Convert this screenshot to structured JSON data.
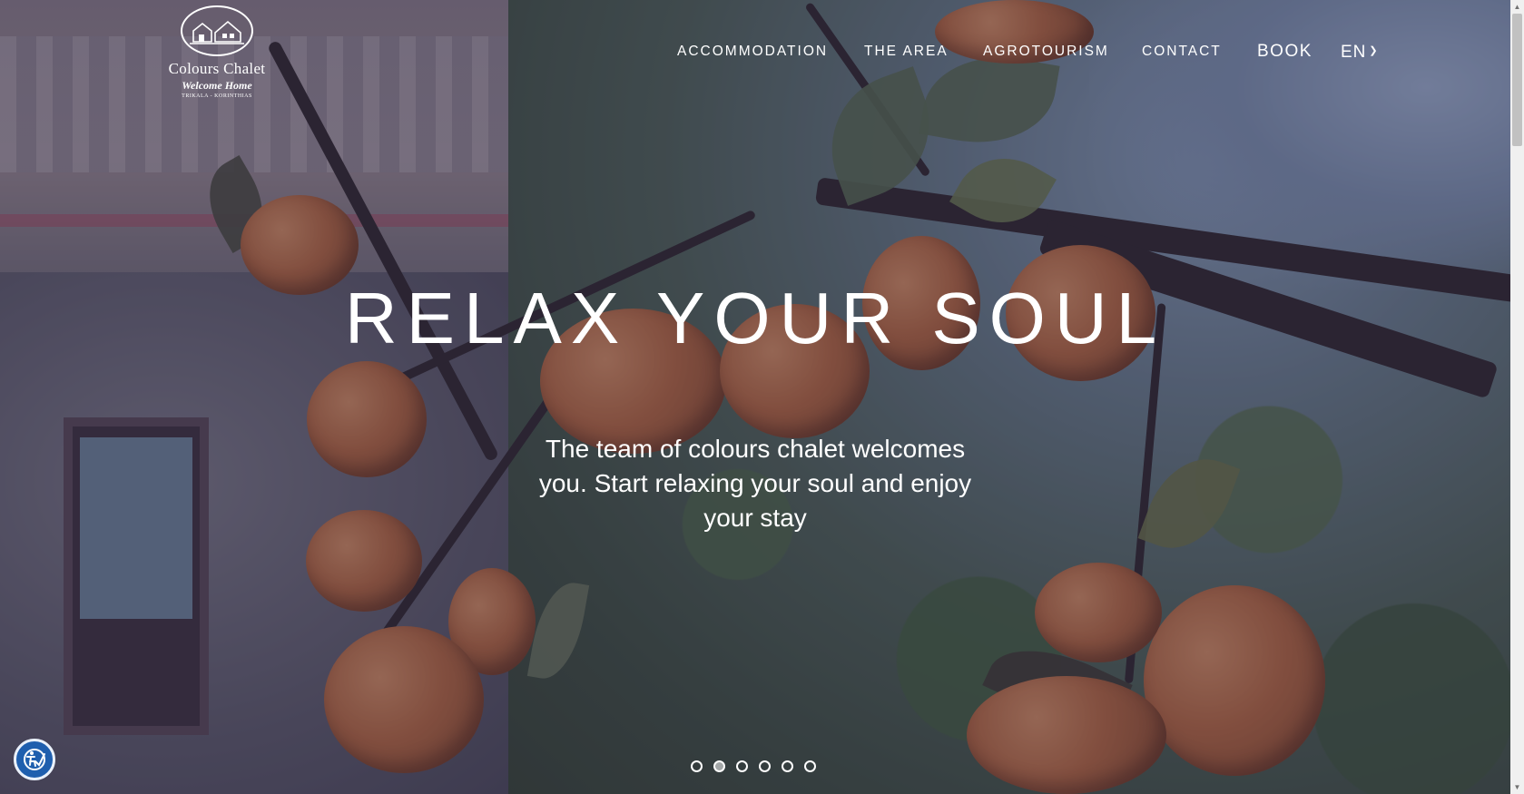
{
  "brand": {
    "name": "Colours Chalet",
    "tagline": "Welcome Home",
    "place": "TRIKALA - KORINTHIAS"
  },
  "nav": {
    "items": [
      {
        "label": "ACCOMMODATION"
      },
      {
        "label": "THE AREA"
      },
      {
        "label": "AGROTOURISM"
      },
      {
        "label": "CONTACT"
      },
      {
        "label": "BOOK"
      }
    ],
    "language": "EN"
  },
  "hero": {
    "title": "RELAX YOUR SOUL",
    "subtitle": "The team of colours chalet welcomes you. Start relaxing your soul and enjoy your stay"
  },
  "slider": {
    "total_slides": 6,
    "active_slide": 2
  },
  "accessibility": {
    "icon": "accessibility-icon",
    "color": "#1f5fae"
  },
  "colors": {
    "overlay": "#28264680",
    "text": "#ffffff"
  }
}
